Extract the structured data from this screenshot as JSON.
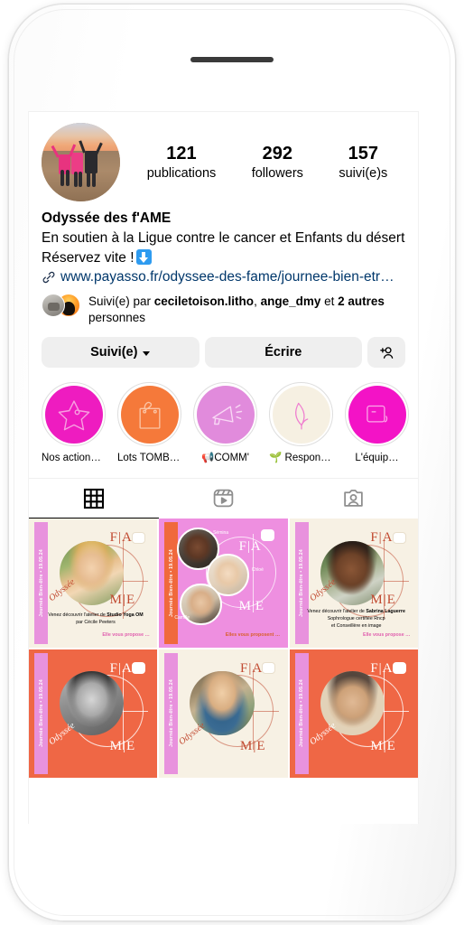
{
  "app": "instagram-profile",
  "device": {
    "type": "white-smartphone-mockup",
    "speaker": "earpiece-slot"
  },
  "profile": {
    "avatar_alt": "group-of-women-in-pink-shirts-celebrating-at-sunset",
    "display_name": "Odyssée des f'AME",
    "bio_line_1": "En soutien à la Ligue contre le cancer et Enfants du désert",
    "bio_line_2": "Réservez vite !",
    "bio_line_2_emoji": "down-arrow-emoji",
    "link_text": "www.payasso.fr/odyssee-des-fame/journee-bien-etr…",
    "link_icon": "chain-link-icon",
    "link_color": "#00376b"
  },
  "stats": [
    {
      "value": "121",
      "label": "publications"
    },
    {
      "value": "292",
      "label": "followers"
    },
    {
      "value": "157",
      "label": "suivi(e)s"
    }
  ],
  "followed_by": {
    "prefix": "Suivi(e) par ",
    "user_1": "ceciletoison.litho",
    "sep_1": ", ",
    "user_2": "ange_dmy",
    "middle": " et ",
    "others_count": "2 autres",
    "suffix": " personnes"
  },
  "actions": {
    "follow_label": "Suivi(e)",
    "follow_chevron": "chevron-down-icon",
    "message_label": "Écrire",
    "add_user_icon": "add-person-icon"
  },
  "highlights": [
    {
      "label": "Nos actions 💗",
      "bg": "#ee1cc0",
      "doodle": "star-icon",
      "doodle_color": "#f79fe0"
    },
    {
      "label": "Lots TOMBOLA",
      "bg": "#f5793a",
      "doodle": "shopping-bag-icon",
      "doodle_color": "#fbc4a4"
    },
    {
      "label": "📢COMM'",
      "bg": "#e18bdc",
      "doodle": "megaphone-icon",
      "doodle_color": "#f6cdf2"
    },
    {
      "label": "🌱 Responsa…",
      "bg": "#f6f0e2",
      "doodle": "leaf-icon",
      "doodle_color": "#ef7fd0"
    },
    {
      "label": "L'équip…",
      "bg": "#f313c6",
      "doodle": "photo-frame-icon",
      "doodle_color": "#fba8e8"
    }
  ],
  "tabs": [
    {
      "name": "grid",
      "icon": "grid-icon",
      "active": true
    },
    {
      "name": "reels",
      "icon": "reels-icon",
      "active": false
    },
    {
      "name": "tagged",
      "icon": "tagged-person-icon",
      "active": false
    }
  ],
  "posts": [
    {
      "bg": "#f7f1e4",
      "sidebar_bg": "#e892dd",
      "sidebar_text": "Journée Bien-être • 19.05.24",
      "sidebar_color": "#ffffff",
      "photo": "blonde-woman-smiling-outdoors",
      "brand_fa": "F|A",
      "brand_me": "M|E",
      "brand_script": "Odyssée",
      "script_color": "#c14a31",
      "caption_a": "Venez découvrir l'atelier de ",
      "caption_b": "Studio Yoga OM",
      "caption_c": "par Cécile Peeters",
      "cta": "Elle vous propose …",
      "cta_color": "#e05fae"
    },
    {
      "bg": "#ee8fe0",
      "sidebar_bg": "#f0693c",
      "sidebar_text": "Journée Bien-être • 19.05.24",
      "sidebar_color": "#ffffff",
      "photo": "three-women-portraits",
      "names": [
        "Sémina",
        "Chloé",
        "Camille"
      ],
      "brand_fa": "F|A",
      "brand_me": "M|E",
      "cta": "Elles vous proposent …",
      "cta_color": "#d85f2c"
    },
    {
      "bg": "#f7f1e4",
      "sidebar_bg": "#e892dd",
      "sidebar_text": "Journée Bien-être • 19.05.24",
      "sidebar_color": "#ffffff",
      "photo": "woman-with-curly-hair-smiling",
      "brand_fa": "F|A",
      "brand_me": "M|E",
      "brand_script": "Odyssée",
      "script_color": "#c14a31",
      "caption_a": "Venez découvrir l'atelier de ",
      "caption_b": "Sabrina Laguerre",
      "caption_c": "Sophrologue certifiée Rncp",
      "caption_d": "et Conseillère en image",
      "cta": "Elle vous propose …",
      "cta_color": "#e05fae"
    },
    {
      "bg": "#ef6745",
      "sidebar_bg": "#e892dd",
      "sidebar_text": "Journée Bien-être • 19.05.24",
      "sidebar_color": "#ffffff",
      "photo": "black-and-white-woman-hand-on-chin",
      "brand_fa": "F|A",
      "brand_me": "M|E",
      "brand_script": "Odyssée",
      "script_color": "#ffffff"
    },
    {
      "bg": "#f7f1e4",
      "sidebar_bg": "#e892dd",
      "sidebar_text": "Journée Bien-être • 19.05.24",
      "sidebar_color": "#ffffff",
      "photo": "woman-in-blue-cardigan-arms-crossed",
      "brand_fa": "F|A",
      "brand_me": "M|E",
      "brand_script": "Odyssée",
      "script_color": "#c14a31"
    },
    {
      "bg": "#ef6745",
      "sidebar_bg": "#e892dd",
      "sidebar_text": "Journée Bien-être • 19.05.24",
      "sidebar_color": "#ffffff",
      "photo": "older-woman-short-hair-portrait",
      "brand_fa": "F|A",
      "brand_me": "M|E",
      "brand_script": "Odyssée",
      "script_color": "#ffffff"
    }
  ]
}
